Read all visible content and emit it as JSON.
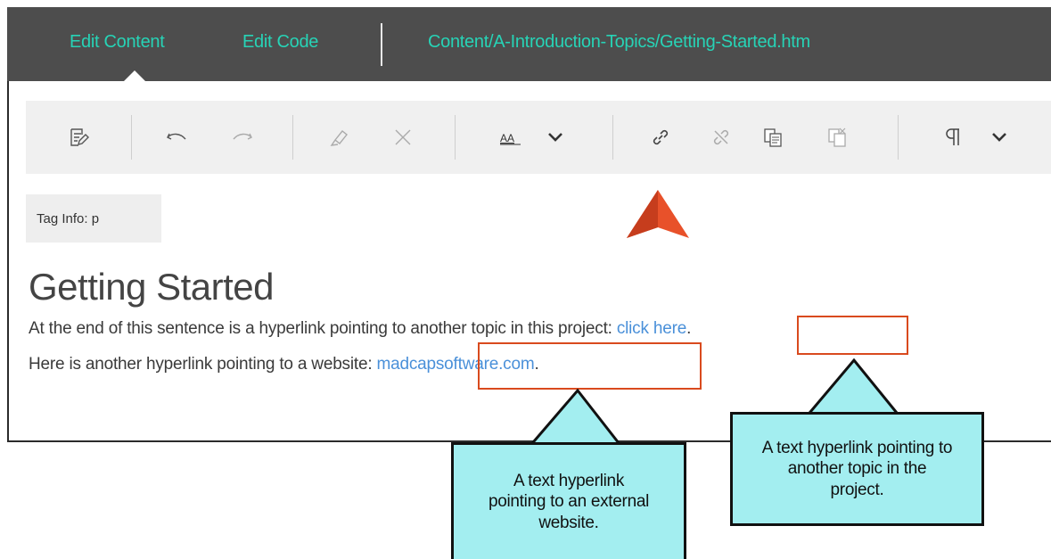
{
  "topbar": {
    "tabs": [
      "Edit Content",
      "Edit Code"
    ],
    "path": "Content/A-Introduction-Topics/Getting-Started.htm"
  },
  "toolbar": {
    "icons": [
      "edit-icon",
      "undo-icon",
      "redo-icon",
      "highlighter-icon",
      "clear-icon",
      "text-size-icon",
      "chevron-down-icon",
      "insert-link-icon",
      "remove-link-icon",
      "copy-icon",
      "paste-icon",
      "pilcrow-icon",
      "chevron-down-icon"
    ]
  },
  "tag_info": "Tag Info: p",
  "document": {
    "heading": "Getting Started",
    "line1_text": "At the end of this sentence is a hyperlink pointing to another topic in this project: ",
    "line1_link": "click here",
    "line1_end": ".",
    "line2_text": "Here is another hyperlink pointing to a website: ",
    "line2_link": "madcapsoftware.com",
    "line2_end": "."
  },
  "callouts": {
    "external": "A text hyperlink pointing to an external website.",
    "internal": "A text hyperlink pointing to another topic in the project."
  },
  "colors": {
    "topbar_bg": "#4d4d4d",
    "tab_text": "#27d3b6",
    "link": "#4a90d9",
    "highlight_box": "#d94a1e",
    "callout_bg": "#a3eef0",
    "pointer": "#e8512a"
  }
}
